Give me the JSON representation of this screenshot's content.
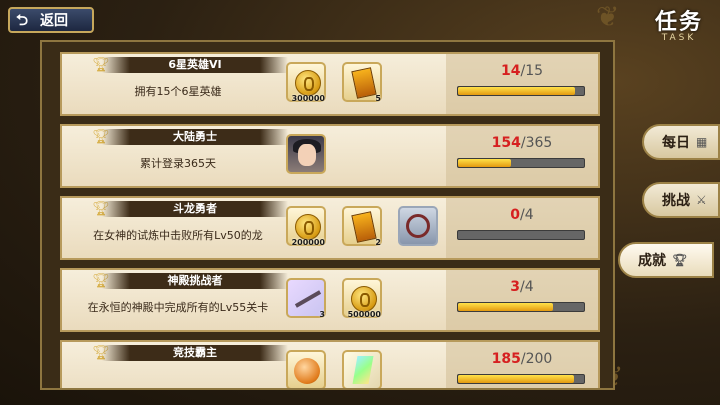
{
  "header": {
    "back_label": "返回",
    "title_cn": "任务",
    "title_en": "TASK"
  },
  "tabs": [
    {
      "label": "每日",
      "icon": "calendar-icon",
      "active": false
    },
    {
      "label": "挑战",
      "icon": "swords-icon",
      "active": false
    },
    {
      "label": "成就",
      "icon": "trophy-icon",
      "active": true
    }
  ],
  "tasks": [
    {
      "name": "6星英雄VI",
      "desc": "拥有15个6星英雄",
      "rewards": [
        {
          "type": "gold-coin",
          "qty": "300000"
        },
        {
          "type": "summon-ticket",
          "qty": "5"
        }
      ],
      "current": "14",
      "total": "15",
      "progress": 0.93
    },
    {
      "name": "大陆勇士",
      "desc": "累计登录365天",
      "rewards": [
        {
          "type": "hero-portrait",
          "qty": ""
        }
      ],
      "current": "154",
      "total": "365",
      "progress": 0.42
    },
    {
      "name": "斗龙勇者",
      "desc": "在女神的试炼中击败所有Lv50的龙",
      "rewards": [
        {
          "type": "gold-coin",
          "qty": "200000"
        },
        {
          "type": "summon-ticket",
          "qty": "2"
        },
        {
          "type": "ring-frame",
          "qty": ""
        }
      ],
      "current": "0",
      "total": "4",
      "progress": 0.0
    },
    {
      "name": "神殿挑战者",
      "desc": "在永恒的神殿中完成所有的Lv55关卡",
      "rewards": [
        {
          "type": "sword",
          "qty": "3"
        },
        {
          "type": "gold-coin",
          "qty": "500000"
        }
      ],
      "current": "3",
      "total": "4",
      "progress": 0.75
    },
    {
      "name": "竞技霸主",
      "desc": "",
      "rewards": [
        {
          "type": "orange-orb",
          "qty": ""
        },
        {
          "type": "crystal",
          "qty": ""
        }
      ],
      "current": "185",
      "total": "200",
      "progress": 0.92
    }
  ]
}
